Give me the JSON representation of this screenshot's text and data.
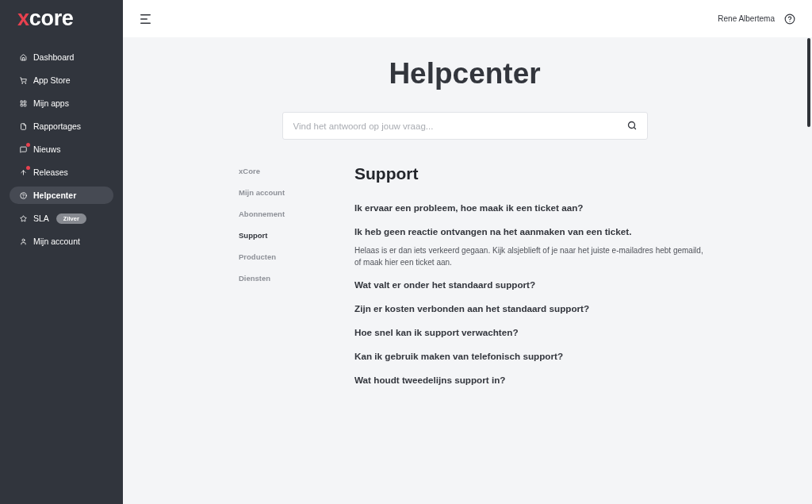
{
  "sidebar": {
    "logo": "xcore",
    "items": [
      {
        "label": "Dashboard",
        "selected": false,
        "notification": false
      },
      {
        "label": "App Store",
        "selected": false,
        "notification": false
      },
      {
        "label": "Mijn apps",
        "selected": false,
        "notification": false
      },
      {
        "label": "Rapportages",
        "selected": false,
        "notification": false
      },
      {
        "label": "Nieuws",
        "selected": false,
        "notification": true
      },
      {
        "label": "Releases",
        "selected": false,
        "notification": true
      },
      {
        "label": "Helpcenter",
        "selected": true,
        "notification": false
      },
      {
        "label": "SLA",
        "selected": false,
        "notification": false,
        "badge": "Zilver"
      },
      {
        "label": "Mijn account",
        "selected": false,
        "notification": false
      }
    ]
  },
  "header": {
    "user_name": "Rene Albertema"
  },
  "helpcenter": {
    "title": "Helpcenter",
    "search": {
      "placeholder": "Vind het antwoord op jouw vraag..."
    }
  },
  "categories": [
    {
      "label": "xCore",
      "selected": false
    },
    {
      "label": "Mijn account",
      "selected": false
    },
    {
      "label": "Abonnement",
      "selected": false
    },
    {
      "label": "Support",
      "selected": true
    },
    {
      "label": "Producten",
      "selected": false
    },
    {
      "label": "Diensten",
      "selected": false
    }
  ],
  "section": {
    "title": "Support",
    "questions": [
      {
        "question": "Ik ervaar een probleem, hoe maak ik een ticket aan?"
      },
      {
        "question": "Ik heb geen reactie ontvangen na het aanmaken van een ticket.",
        "answer": "Helaas is er dan iets verkeerd gegaan. Kijk alsjeblieft of je naar het juiste e-mailadres hebt gemaild, of maak hier een ticket aan."
      },
      {
        "question": "Wat valt er onder het standaard support?"
      },
      {
        "question": "Zijn er kosten verbonden aan het standaard support?"
      },
      {
        "question": "Hoe snel kan ik support verwachten?"
      },
      {
        "question": "Kan ik gebruik maken van telefonisch support?"
      },
      {
        "question": "Wat houdt tweedelijns support in?"
      }
    ]
  }
}
